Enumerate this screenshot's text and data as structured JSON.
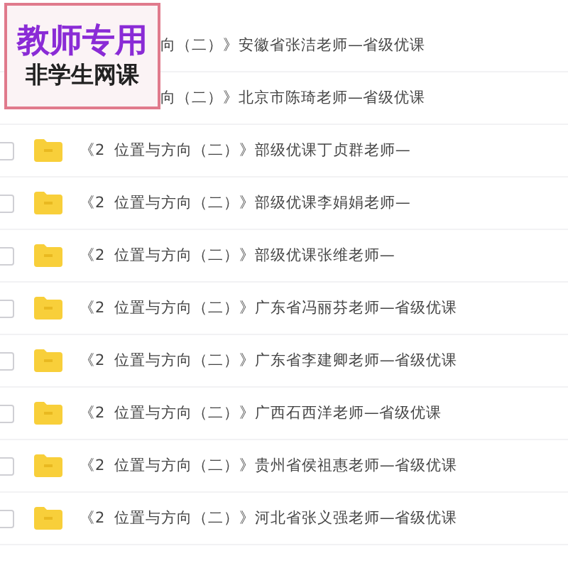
{
  "badge": {
    "title": "教师专用",
    "subtitle": "非学生网课"
  },
  "files": [
    {
      "kind": "partial",
      "name": "向（二）》安徽省张洁老师—省级优课"
    },
    {
      "kind": "partial",
      "name": "向（二）》北京市陈琦老师—省级优课"
    },
    {
      "kind": "full",
      "checked": false,
      "name": "《2  位置与方向（二）》部级优课丁贞群老师—"
    },
    {
      "kind": "full",
      "checked": false,
      "name": "《2  位置与方向（二）》部级优课李娟娟老师—"
    },
    {
      "kind": "full",
      "checked": false,
      "name": "《2  位置与方向（二）》部级优课张维老师—"
    },
    {
      "kind": "full",
      "checked": false,
      "name": "《2  位置与方向（二）》广东省冯丽芬老师—省级优课"
    },
    {
      "kind": "full",
      "checked": false,
      "name": "《2  位置与方向（二）》广东省李建卿老师—省级优课"
    },
    {
      "kind": "full",
      "checked": false,
      "name": "《2  位置与方向（二）》广西石西洋老师—省级优课"
    },
    {
      "kind": "full",
      "checked": false,
      "name": "《2  位置与方向（二）》贵州省侯祖惠老师—省级优课"
    },
    {
      "kind": "full",
      "checked": false,
      "name": "《2  位置与方向（二）》河北省张义强老师—省级优课"
    }
  ]
}
